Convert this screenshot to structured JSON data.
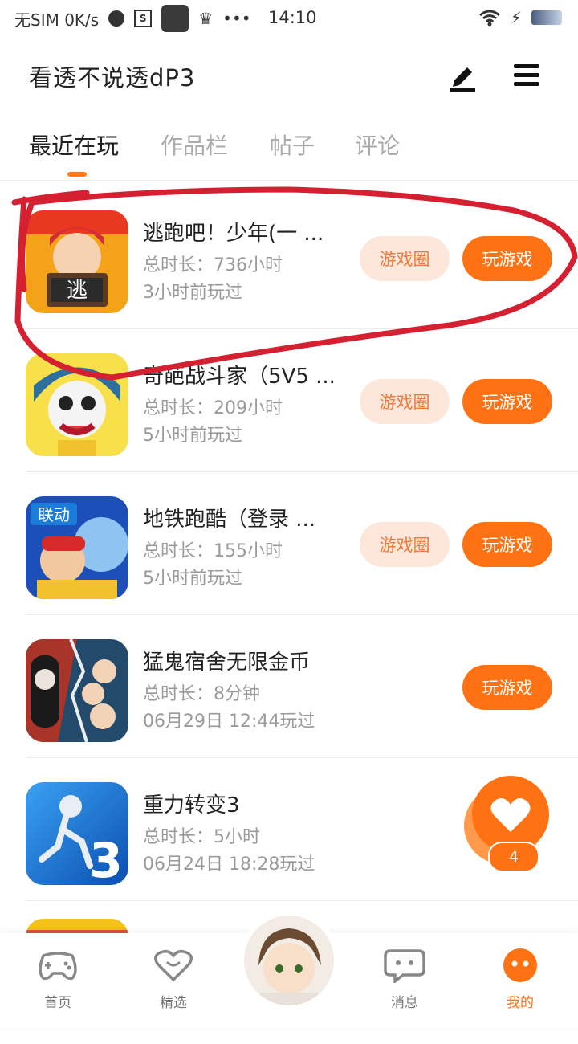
{
  "status_bar": {
    "carrier": "无SIM 0K/s",
    "time": "14:10"
  },
  "header": {
    "title": "看透不说透dP3"
  },
  "tabs": [
    {
      "label": "最近在玩",
      "active": true
    },
    {
      "label": "作品栏",
      "active": false
    },
    {
      "label": "帖子",
      "active": false
    },
    {
      "label": "评论",
      "active": false
    }
  ],
  "games": [
    {
      "name": "逃跑吧！少年(一 ...",
      "duration": "总时长：736小时",
      "last_played": "3小时前玩过",
      "circle_btn": "游戏圈",
      "play_btn": "玩游戏"
    },
    {
      "name": "奇葩战斗家（5V5 ...",
      "duration": "总时长：209小时",
      "last_played": "5小时前玩过",
      "circle_btn": "游戏圈",
      "play_btn": "玩游戏"
    },
    {
      "name": "地铁跑酷（登录 ...",
      "duration": "总时长：155小时",
      "last_played": "5小时前玩过",
      "circle_btn": "游戏圈",
      "play_btn": "玩游戏"
    },
    {
      "name": "猛鬼宿舍无限金币",
      "duration": "总时长：8分钟",
      "last_played": "06月29日 12:44玩过",
      "circle_btn": "",
      "play_btn": "玩游戏"
    },
    {
      "name": "重力转变3",
      "duration": "总时长：5小时",
      "last_played": "06月24日 18:28玩过",
      "circle_btn": "",
      "play_btn": ""
    }
  ],
  "icon_texts": {
    "game1": "逃",
    "game3": "联动",
    "game5": "3"
  },
  "float_like": {
    "count": "4"
  },
  "bottom_nav": [
    {
      "label": "首页"
    },
    {
      "label": "精选"
    },
    {
      "label": "消息"
    },
    {
      "label": "我的"
    }
  ],
  "colors": {
    "accent": "#ff7213",
    "circle_btn_bg": "#fde7da",
    "annotation": "#d42030"
  }
}
